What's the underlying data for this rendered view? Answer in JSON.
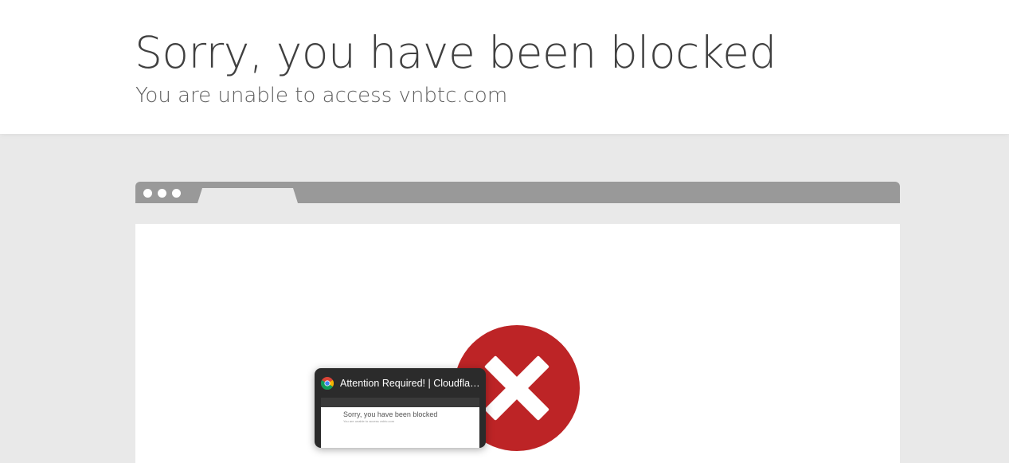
{
  "header": {
    "title": "Sorry, you have been blocked",
    "subtitle": "You are unable to access vnbtc.com"
  },
  "illustration": {
    "browser_dots": 3,
    "error_icon": "x-circle-icon",
    "error_color": "#bd2426"
  },
  "tab_preview": {
    "favicon": "chrome-icon",
    "title": "Attention Required! | Cloudflar...",
    "thumbnail_title": "Sorry, you have been blocked",
    "thumbnail_subtitle": "You are unable to access vnbtc.com"
  },
  "colors": {
    "page_background": "#e9e9e9",
    "header_background": "#ffffff",
    "browser_bar": "#999999",
    "popup_background": "#2b2b2b"
  }
}
